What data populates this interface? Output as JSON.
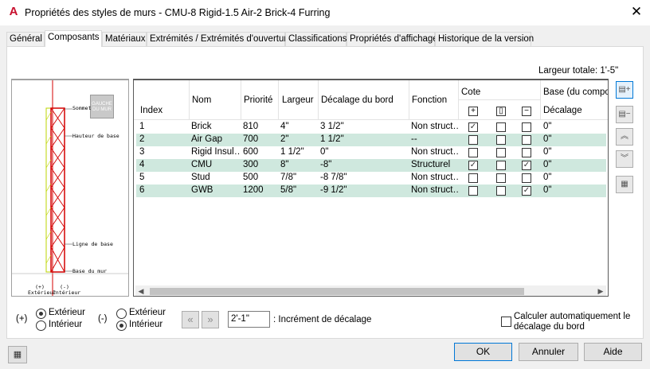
{
  "title": "Propriétés des styles de murs - CMU-8 Rigid-1.5 Air-2 Brick-4 Furring",
  "tabs": [
    "Général",
    "Composants",
    "Matériaux",
    "Extrémités / Extrémités d'ouverture",
    "Classifications",
    "Propriétés d'affichage",
    "Historique de la version"
  ],
  "largeur_totale": "Largeur totale: 1'-5\"",
  "preview": {
    "gauche": "GAUCHE DU MUR",
    "labels": {
      "sommet": "Sommet",
      "hauteur": "Hauteur de base",
      "ligne": "Ligne de base",
      "base": "Base du mur",
      "ext": "(+)\nExtérieur",
      "int": "(-)\nIntérieur"
    }
  },
  "grid": {
    "headers": {
      "index": "Index",
      "nom": "Nom",
      "priorite": "Priorité",
      "largeur": "Largeur",
      "decalage": "Décalage du bord",
      "fonction": "Fonction",
      "cote": "Cote",
      "base": "Base (du compo",
      "base_decalage": "Décalage"
    },
    "rows": [
      {
        "index": "1",
        "nom": "Brick",
        "priorite": "810",
        "largeur": "4\"",
        "decalage": "3 1/2\"",
        "fonction": "Non struct…",
        "c1": true,
        "c2": false,
        "c3": false,
        "base": "0\""
      },
      {
        "index": "2",
        "nom": "Air Gap",
        "priorite": "700",
        "largeur": "2\"",
        "decalage": "1 1/2\"",
        "fonction": "--",
        "c1": false,
        "c2": false,
        "c3": false,
        "base": "0\""
      },
      {
        "index": "3",
        "nom": "Rigid Insul…",
        "priorite": "600",
        "largeur": "1 1/2\"",
        "decalage": "0\"",
        "fonction": "Non struct…",
        "c1": false,
        "c2": false,
        "c3": false,
        "base": "0\""
      },
      {
        "index": "4",
        "nom": "CMU",
        "priorite": "300",
        "largeur": "8\"",
        "decalage": "-8\"",
        "fonction": "Structurel",
        "c1": true,
        "c2": false,
        "c3": true,
        "base": "0\""
      },
      {
        "index": "5",
        "nom": "Stud",
        "priorite": "500",
        "largeur": "7/8\"",
        "decalage": "-8 7/8\"",
        "fonction": "Non struct…",
        "c1": false,
        "c2": false,
        "c3": false,
        "base": "0\""
      },
      {
        "index": "6",
        "nom": "GWB",
        "priorite": "1200",
        "largeur": "5/8\"",
        "decalage": "-9 1/2\"",
        "fonction": "Non struct…",
        "c1": false,
        "c2": false,
        "c3": true,
        "base": "0\""
      }
    ]
  },
  "bottom": {
    "plus": "(+)",
    "minus": "(-)",
    "exterieur": "Extérieur",
    "interieur": "Intérieur",
    "increment_value": "2'-1\"",
    "increment_label": ": Incrément de décalage",
    "calc_label_1": "Calculer automatiquement le",
    "calc_label_2": "décalage du bord"
  },
  "buttons": {
    "ok": "OK",
    "annuler": "Annuler",
    "aide": "Aide"
  }
}
